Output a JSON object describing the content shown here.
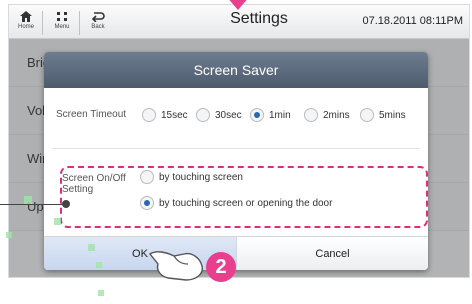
{
  "topbar": {
    "home_label": "Home",
    "menu_label": "Menu",
    "back_label": "Back",
    "title": "Settings",
    "datetime": "07.18.2011 08:11PM"
  },
  "background_list": [
    "Brigl",
    "Volu",
    "Wire",
    "Upd"
  ],
  "dialog": {
    "title": "Screen Saver",
    "timeout_label": "Screen Timeout",
    "timeout_options": [
      "15sec",
      "30sec",
      "1min",
      "2mins",
      "5mins"
    ],
    "timeout_selected": "1min",
    "onoff_label": "Screen On/Off Setting",
    "onoff_options": [
      "by touching screen",
      "by touching screen or opening the door"
    ],
    "onoff_selected": "by touching screen or opening the door",
    "ok_label": "OK",
    "cancel_label": "Cancel"
  },
  "callout_step": "2",
  "colors": {
    "accent": "#e8408e",
    "header": "#5a687a",
    "radio_on": "#2a68b3"
  }
}
